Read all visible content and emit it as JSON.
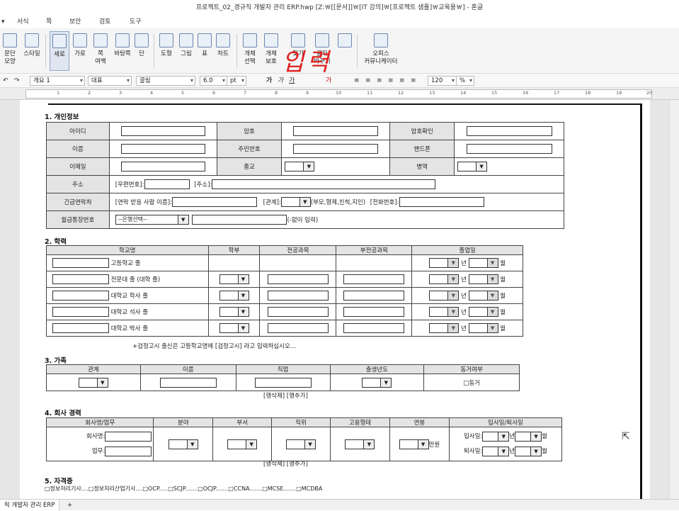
{
  "window": {
    "title": "프로젝트_02_경규직 개발자 관리 ERP.hwp [Z:￦[[문서]]￦[IT 강의]￦[프로젝트 샘플]￦교육용￦] - 혼글"
  },
  "menu": {
    "items": [
      "서식",
      "쪽",
      "보안",
      "검토",
      "도구"
    ]
  },
  "ribbon": {
    "groups": [
      "문단\n모양",
      "스타일",
      "세로",
      "가로",
      "쪽\n여백",
      "바탕쪽",
      "단",
      "도형",
      "그림",
      "표",
      "차트",
      "개체\n선택",
      "개체\n보호",
      "찾기",
      "글자\n바꾸기",
      "",
      "오피스\n커뮤니케이터"
    ],
    "handwriting": "입력"
  },
  "format": {
    "style": "개요 1",
    "lang": "대표",
    "font": "굴림",
    "size": "6.0",
    "unit": "pt",
    "zoom": "120",
    "zoom_unit": "%"
  },
  "ruler": {
    "numbers": [
      "1",
      "2",
      "3",
      "4",
      "5",
      "6",
      "7",
      "8",
      "9",
      "10",
      "11",
      "12",
      "13",
      "14",
      "15",
      "16",
      "17",
      "18",
      "19",
      "20"
    ]
  },
  "form": {
    "s1": {
      "title": "1. 개인정보",
      "id": "아이디",
      "pw": "암호",
      "pwc": "암호확인",
      "name": "이름",
      "ssn": "주민번호",
      "phone": "핸드폰",
      "email": "이메일",
      "religion": "종교",
      "military": "병역",
      "address": "주소",
      "zip": "[우편번호]:",
      "addr": "[주소]:",
      "emergency": "긴급연락처",
      "contact_name": "[연락 받을 사람 이름]:",
      "relation": "[관계]:",
      "relation_hint": "(부모,형제,친척,지인)",
      "tel": "[전화번호]:",
      "account": "월급통장번호",
      "bank": "--은행선택--",
      "account_hint": "(-없이 입력)"
    },
    "s2": {
      "title": "2. 학력",
      "headers": [
        "학교명",
        "학부",
        "전공과목",
        "부전공과목",
        "졸업일"
      ],
      "rows": [
        "고등학교 졸",
        "전문대 졸 (대학 졸)",
        "대학교 학사 졸",
        "대학교 석사 졸",
        "대학교 박사 졸"
      ],
      "year": "년",
      "month": "월",
      "note": "+검정고시 출신은 고등학교명에 [검정고시] 라고 입력하십시오..."
    },
    "s3": {
      "title": "3. 가족",
      "headers": [
        "관계",
        "이름",
        "직업",
        "출생년도",
        "동거여부"
      ],
      "cohabit": "□동거",
      "links": "[행삭제] [행추가]"
    },
    "s4": {
      "title": "4. 회사 경력",
      "headers": [
        "회사명/업무",
        "분야",
        "부서",
        "직위",
        "고용형태",
        "연봉",
        "입사일/퇴사일"
      ],
      "company": "회사명:",
      "job": "업무:",
      "unit": "만원",
      "join": "입사일:",
      "leave": "퇴사일:",
      "year": "년",
      "month": "월",
      "links": "[행삭제] [행추가]"
    },
    "s5": {
      "title": "5. 자격증",
      "items": "□정보처리기사....□정보처리산업기사....□OCP.....□SCJP.......□OCJP.......□CCNA.......□MCSE.......□MCDBA"
    }
  },
  "tabs": {
    "doc": "릭 개발자 관리 ERP",
    "add": "+"
  }
}
